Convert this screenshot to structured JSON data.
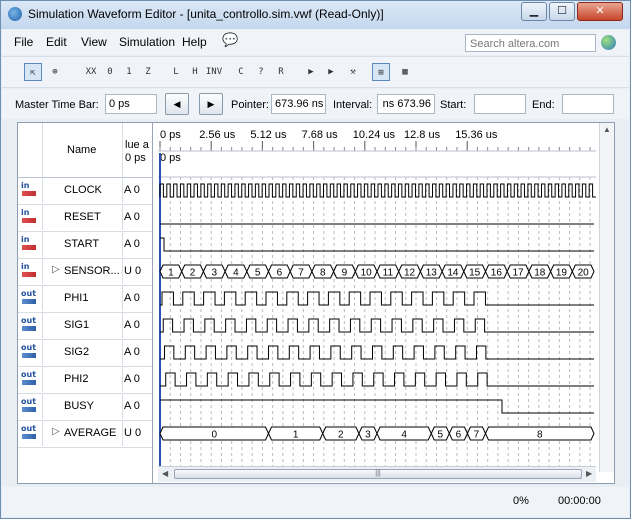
{
  "window": {
    "title": "Simulation Waveform Editor - [unita_controllo.sim.vwf (Read-Only)]",
    "app_icon": "quartus-icon",
    "controls": [
      "minimize-icon",
      "maximize-icon",
      "close-icon"
    ]
  },
  "menu": {
    "items": [
      "File",
      "Edit",
      "View",
      "Simulation",
      "Help"
    ],
    "search_placeholder": "Search altera.com"
  },
  "toolbar": {
    "buttons": [
      {
        "icon": "select-tool-icon",
        "glyph": "⇱"
      },
      {
        "icon": "zoom-tool-icon",
        "glyph": "⊕"
      },
      {
        "icon": "force-unknown-icon",
        "glyph": "XX"
      },
      {
        "icon": "force-low-icon",
        "glyph": "0"
      },
      {
        "icon": "force-high-icon",
        "glyph": "1"
      },
      {
        "icon": "force-high-impedance-icon",
        "glyph": "Z"
      },
      {
        "icon": "weak-low-icon",
        "glyph": "L"
      },
      {
        "icon": "weak-high-icon",
        "glyph": "H"
      },
      {
        "icon": "invert-icon",
        "glyph": "INV"
      },
      {
        "icon": "count-value-icon",
        "glyph": "C"
      },
      {
        "icon": "dont-care-icon",
        "glyph": "?"
      },
      {
        "icon": "random-value-icon",
        "glyph": "R"
      },
      {
        "icon": "run-functional-simulation-icon",
        "glyph": "▶"
      },
      {
        "icon": "run-timing-simulation-icon",
        "glyph": "▶"
      },
      {
        "icon": "generate-netlist-icon",
        "glyph": "⚒"
      },
      {
        "icon": "snap-to-grid-icon",
        "glyph": "⊞"
      },
      {
        "icon": "grid-icon",
        "glyph": "▦"
      }
    ]
  },
  "timebar": {
    "master_label": "Master Time Bar:",
    "master_value": "0 ps",
    "pointer_label": "Pointer:",
    "pointer_value": "673.96 ns",
    "interval_label": "Interval:",
    "interval_value": "673.96 ns",
    "start_label": "Start:",
    "start_value": "",
    "end_label": "End:",
    "end_value": ""
  },
  "table": {
    "name_header": "Name",
    "value_header_line1": "lue a",
    "value_header_line2": "0 ps",
    "time_marker_label": "0 ps"
  },
  "time_axis": {
    "labels": [
      "0 ps",
      "2.56 us",
      "5.12 us",
      "7.68 us",
      "10.24 us",
      "12.8 us",
      "15.36 us"
    ]
  },
  "signals": [
    {
      "dir": "in",
      "name": "CLOCK",
      "value": "A 0",
      "kind": "clock",
      "periods": 64
    },
    {
      "dir": "in",
      "name": "RESET",
      "value": "A 0",
      "kind": "low"
    },
    {
      "dir": "in",
      "name": "START",
      "value": "A 0",
      "kind": "pulse",
      "high_until": 0.16
    },
    {
      "dir": "in",
      "name": "SENSOR...",
      "value": "U 0",
      "kind": "bus",
      "expandable": true,
      "segments": [
        "1",
        "2",
        "3",
        "4",
        "5",
        "6",
        "7",
        "8",
        "9",
        "10",
        "11",
        "12",
        "13",
        "14",
        "15",
        "16",
        "17",
        "18",
        "19",
        "20"
      ]
    },
    {
      "dir": "out",
      "name": "PHI1",
      "value": "A 0",
      "kind": "pulses",
      "count": 16,
      "duty": 0.55,
      "phase": 0.0,
      "stop_after": 16
    },
    {
      "dir": "out",
      "name": "SIG1",
      "value": "A 0",
      "kind": "pulses",
      "count": 16,
      "duty": 0.45,
      "phase": 0.15,
      "stop_after": 16
    },
    {
      "dir": "out",
      "name": "SIG2",
      "value": "A 0",
      "kind": "pulses",
      "count": 16,
      "duty": 0.45,
      "phase": 0.3,
      "stop_after": 16
    },
    {
      "dir": "out",
      "name": "PHI2",
      "value": "A 0",
      "kind": "pulses",
      "count": 16,
      "duty": 0.45,
      "phase": 0.45,
      "stop_after": 16
    },
    {
      "dir": "out",
      "name": "BUSY",
      "value": "A 0",
      "kind": "busy"
    },
    {
      "dir": "out",
      "name": "AVERAGE",
      "value": "U 0",
      "kind": "bus",
      "expandable": true,
      "segments": [
        "0",
        "1",
        "2",
        "3",
        "4",
        "5",
        "6",
        "7",
        "8"
      ],
      "widths": [
        6,
        3,
        2,
        1,
        3,
        1,
        1,
        1,
        6
      ]
    }
  ],
  "status": {
    "progress": "0%",
    "elapsed": "00:00:00"
  }
}
